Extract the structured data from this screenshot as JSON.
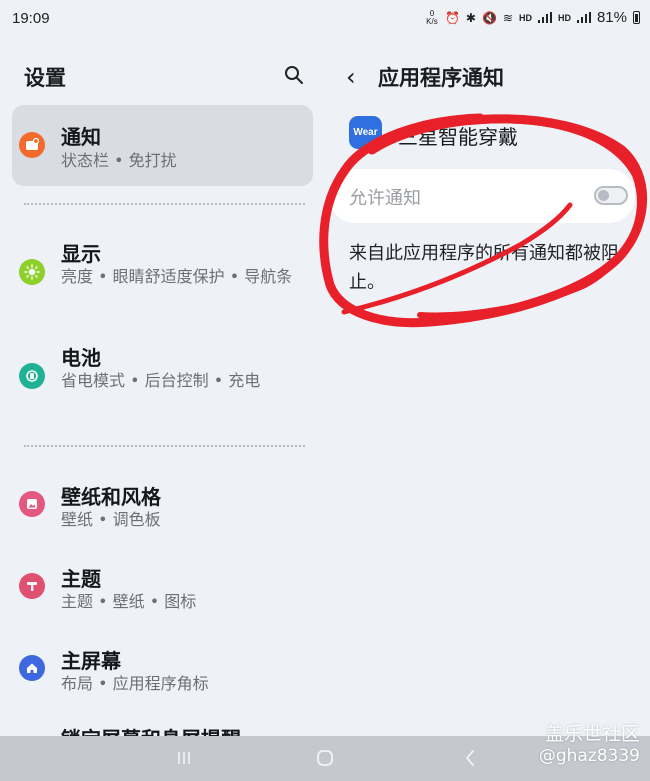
{
  "status_bar": {
    "time": "19:09",
    "network_speed": "0 K/s",
    "hd_1": "HD",
    "hd_2": "HD",
    "battery": "81%"
  },
  "settings": {
    "title": "设置",
    "items": [
      {
        "title": "通知",
        "subtitle": "状态栏 • 免打扰",
        "icon": "notification-icon",
        "color": "#f26b2c",
        "selected": true
      },
      {
        "title": "显示",
        "subtitle": "亮度 • 眼睛舒适度保护 • 导航条",
        "icon": "display-sun-icon",
        "color": "#8fcf2a"
      },
      {
        "title": "电池",
        "subtitle": "省电模式 • 后台控制 • 充电",
        "icon": "battery-icon",
        "color": "#1fb394"
      },
      {
        "title": "壁纸和风格",
        "subtitle": "壁纸 • 调色板",
        "icon": "wallpaper-icon",
        "color": "#e4577f"
      },
      {
        "title": "主题",
        "subtitle": "主题 • 壁纸 • 图标",
        "icon": "theme-icon",
        "color": "#e0506f"
      },
      {
        "title": "主屏幕",
        "subtitle": "布局 • 应用程序角标",
        "icon": "home-icon",
        "color": "#3d68e0"
      },
      {
        "title": "锁定屏幕和息屏提醒",
        "subtitle": "",
        "icon": "lock-icon",
        "color": "#4a62d8"
      }
    ]
  },
  "app_notifications": {
    "title": "应用程序通知",
    "app_icon_text": "Wear",
    "app_name": "三星智能穿戴",
    "allow_label": "允许通知",
    "allow_enabled": false,
    "blocked_message": "来自此应用程序的所有通知都被阻止。"
  },
  "watermark": {
    "line1": "盖乐世社区",
    "line2": "@ghaz8339"
  },
  "colors": {
    "background": "#eef1f6",
    "selected_item": "#d9dce2",
    "annotation_red": "#e8202a",
    "app_icon": "#2f6fe0"
  }
}
